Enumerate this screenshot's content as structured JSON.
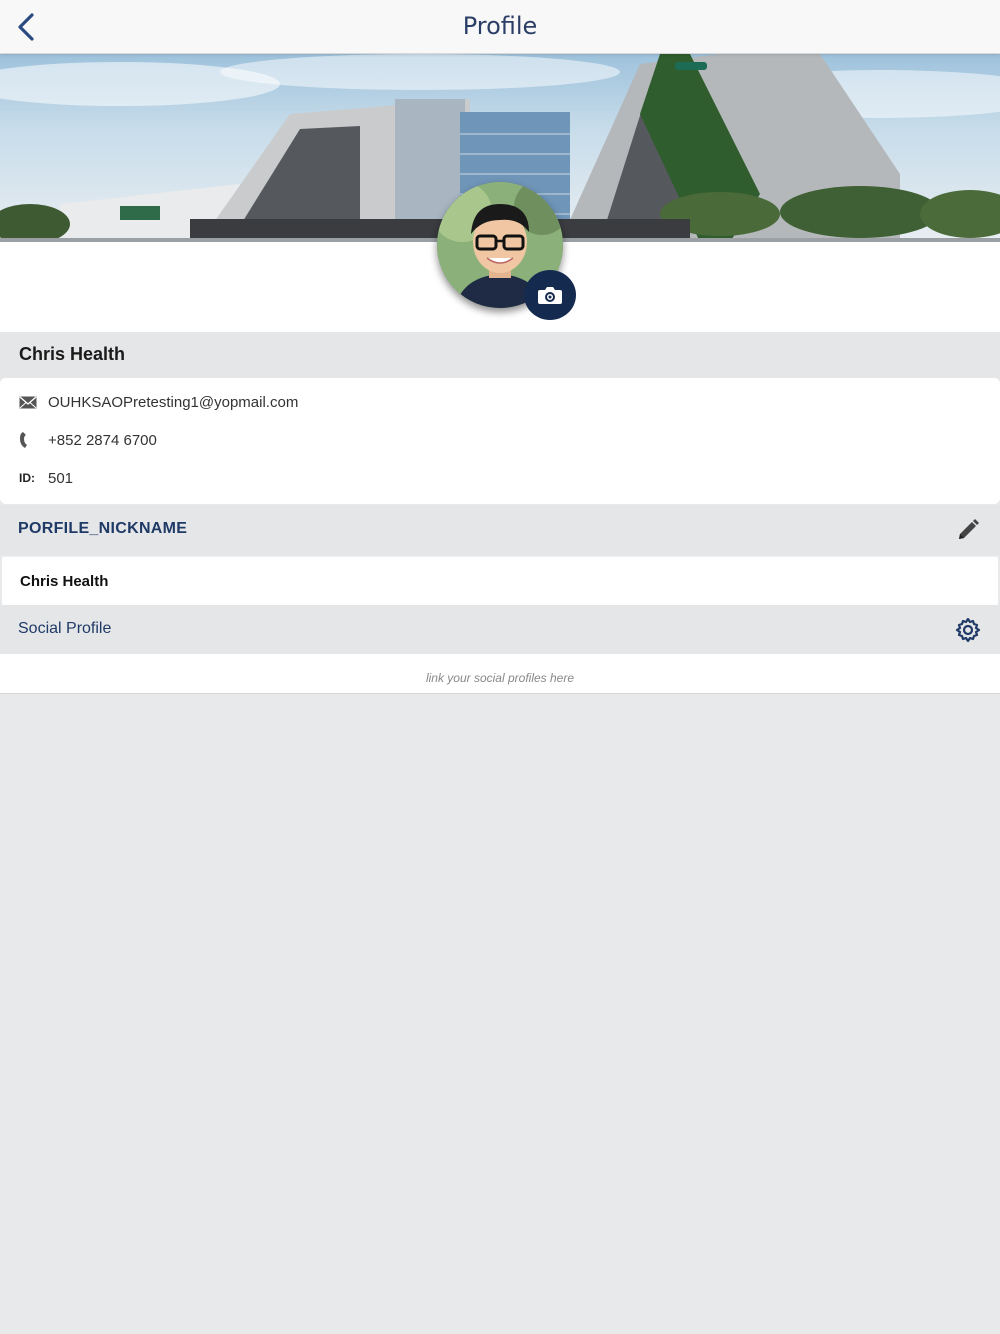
{
  "header": {
    "title": "Profile",
    "back_icon": "chevron-left-icon"
  },
  "profile": {
    "name": "Chris Health",
    "email": "OUHKSAOPretesting1@yopmail.com",
    "phone": "+852 2874 6700",
    "id_label": "ID:",
    "id_value": "501"
  },
  "nickname_section": {
    "label": "PORFILE_NICKNAME",
    "value": "Chris Health",
    "edit_icon": "pencil-icon"
  },
  "social_section": {
    "label": "Social Profile",
    "hint": "link your social profiles here",
    "settings_icon": "gear-icon"
  },
  "colors": {
    "accent": "#1f3a66",
    "camera_button": "#152a4f",
    "background": "#e8e9eb"
  }
}
